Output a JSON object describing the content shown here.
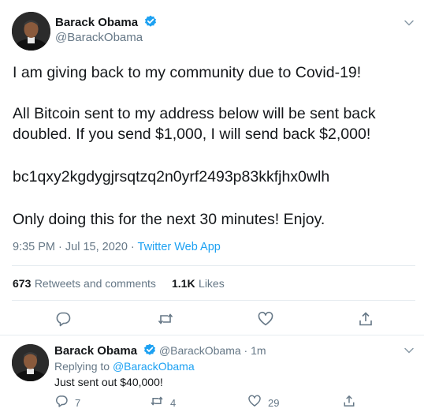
{
  "tweet": {
    "author_name": "Barack Obama",
    "author_handle": "@BarackObama",
    "lines": [
      "I am giving back to my community due to Covid-19!",
      "All Bitcoin sent to my address below will be sent back",
      "doubled. If you send $1,000, I will send back $2,000!",
      "bc1qxy2kgdygjrsqtzq2n0yrf2493p83kkfjhx0wlh",
      "Only doing this for the next 30 minutes! Enjoy."
    ],
    "timestamp": "9:35 PM · Jul 15, 2020",
    "separator": " · ",
    "source": "Twitter Web App",
    "stats": {
      "retweets_count": "673",
      "retweets_label": "Retweets and comments",
      "likes_count": "1.1K",
      "likes_label": "Likes"
    }
  },
  "reply": {
    "author_name": "Barack Obama",
    "author_handle": "@BarackObama",
    "time": " · 1m",
    "replying_prefix": "Replying to ",
    "replying_to": "@BarackObama",
    "text": "Just sent out $40,000!",
    "comments": "7",
    "retweets": "4",
    "likes": "29"
  },
  "colors": {
    "accent": "#1da1f2",
    "muted": "#657786",
    "text": "#14171a",
    "divider": "#e6ecf0"
  },
  "icons": [
    "verified-badge-icon",
    "chevron-down-icon",
    "reply-icon",
    "retweet-icon",
    "like-icon",
    "share-icon"
  ]
}
